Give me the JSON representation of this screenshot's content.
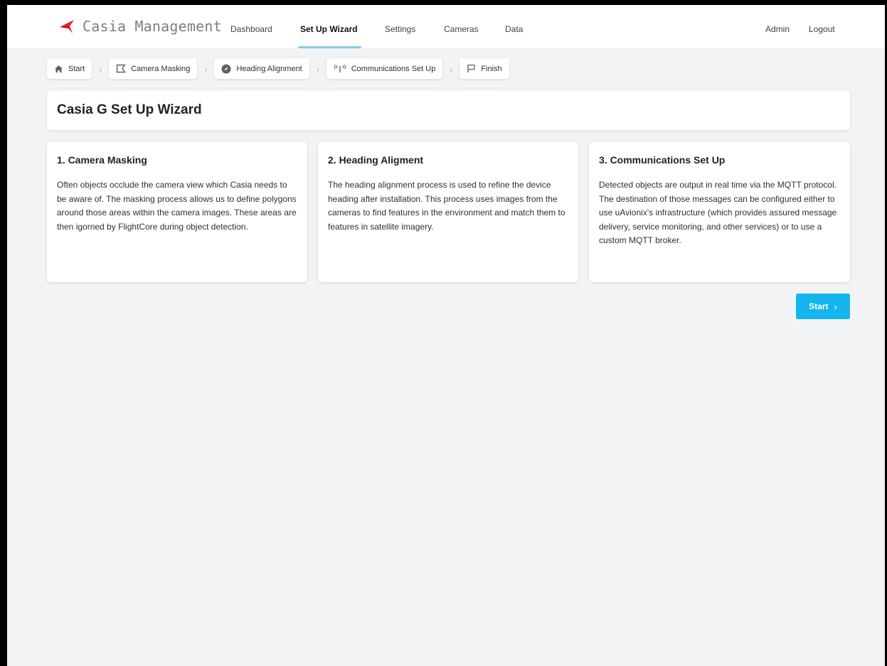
{
  "app": {
    "title": "Casia Management",
    "brand_color": "#e8212b"
  },
  "nav": {
    "items": [
      "Dashboard",
      "Set Up Wizard",
      "Settings",
      "Cameras",
      "Data"
    ],
    "active": "Set Up Wizard",
    "right": [
      "Admin",
      "Logout"
    ]
  },
  "breadcrumb": [
    {
      "label": "Start",
      "icon": "home-icon"
    },
    {
      "label": "Camera Masking",
      "icon": "mask-icon"
    },
    {
      "label": "Heading Alignment",
      "icon": "compass-icon"
    },
    {
      "label": "Communications Set Up",
      "icon": "antenna-icon"
    },
    {
      "label": "Finish",
      "icon": "flag-icon"
    }
  ],
  "page_title": "Casia G Set Up Wizard",
  "steps": [
    {
      "title": "1. Camera Masking",
      "text": "Often objects occlude the camera view which Casia needs to be aware of. The masking process allows us to define polygons around those areas within the camera images. These areas are then igorned by FlightCore during object detection."
    },
    {
      "title": "2. Heading Aligment",
      "text": "The heading alignment process is used to refine the device heading after installation. This process uses images from the cameras to find features in the environment and match them to features in satellite imagery."
    },
    {
      "title": "3. Communications Set Up",
      "text": "Detected objects are output in real time via the MQTT protocol. The destination of those messages can be configured either to use uAvionix's infrastructure (which provides assured message delivery, service monitoring, and other services) or to use a custom MQTT broker."
    }
  ],
  "start_button": {
    "label": "Start",
    "color": "#13b5ee"
  }
}
